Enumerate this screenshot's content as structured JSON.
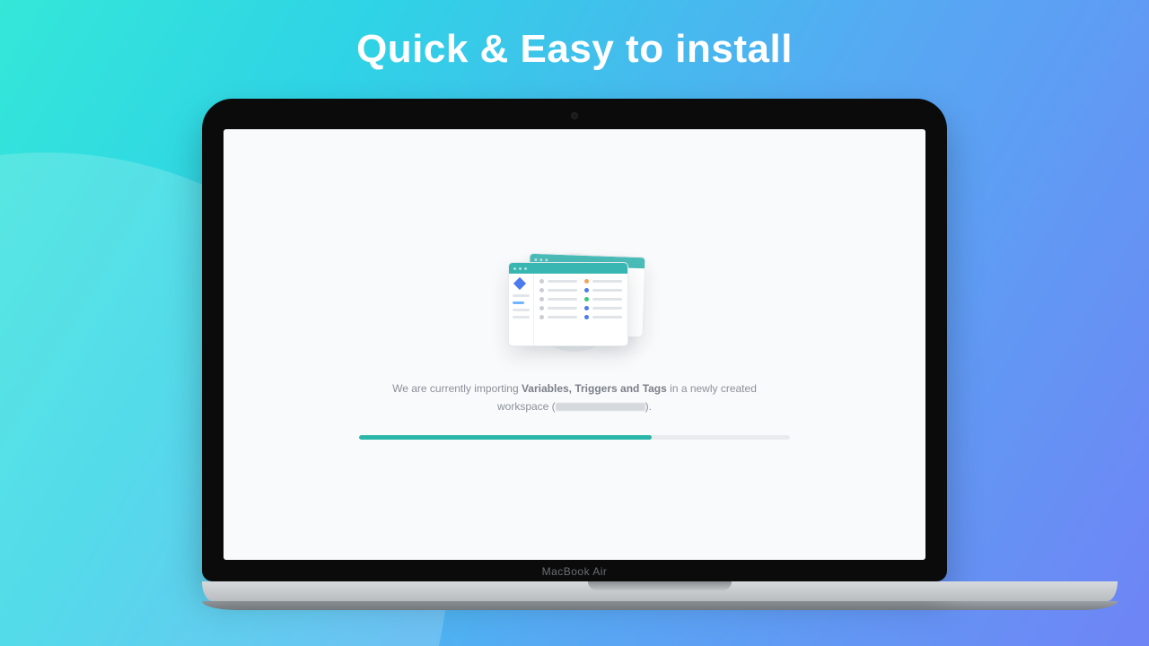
{
  "headline": "Quick & Easy to install",
  "device_label": "MacBook Air",
  "status": {
    "prefix": "We are currently importing ",
    "strong": "Variables, Triggers and Tags",
    "mid": " in a newly created workspace (",
    "suffix": ")."
  },
  "progress_percent": 68
}
